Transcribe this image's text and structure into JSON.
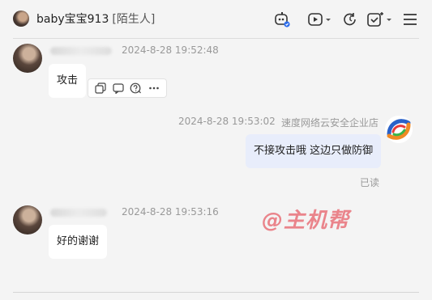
{
  "header": {
    "contact_name": "baby宝宝913",
    "contact_tag": "[陌生人]",
    "icons": [
      "robot-icon",
      "video-call-icon",
      "history-icon",
      "add-task-icon",
      "menu-icon"
    ]
  },
  "messages": [
    {
      "side": "left",
      "time": "2024-8-28 19:52:48",
      "text": "攻击",
      "actions": [
        "copy-icon",
        "reply-icon",
        "help-icon",
        "more-icon"
      ]
    },
    {
      "side": "right",
      "time": "2024-8-28 19:53:02",
      "sender": "速度网络云安全企业店",
      "text": "不接攻击哦 这边只做防御",
      "status": "已读"
    },
    {
      "side": "left",
      "time": "2024-8-28 19:53:16",
      "text": "好的谢谢"
    }
  ],
  "watermark": "@主机帮",
  "colors": {
    "my_bubble": "#e8edfb",
    "their_bubble": "#ffffff",
    "watermark": "#e87078",
    "background": "#f4f4f4"
  }
}
